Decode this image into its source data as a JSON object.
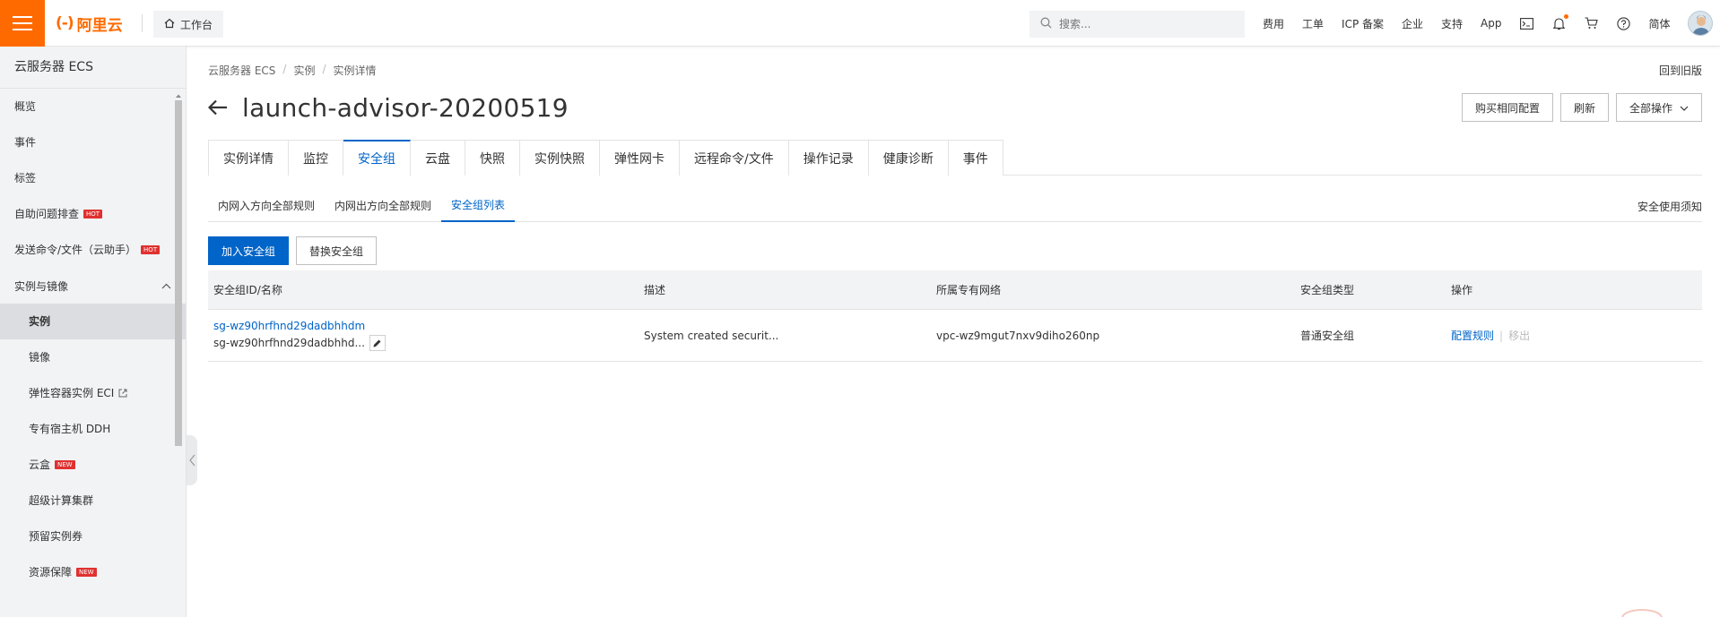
{
  "topbar": {
    "logo_mark": "(-)",
    "logo_text": "阿里云",
    "workbench": "工作台",
    "search_placeholder": "搜索...",
    "links": [
      "费用",
      "工单",
      "ICP 备案",
      "企业",
      "支持",
      "App"
    ],
    "lang": "简体",
    "icons": [
      "terminal-icon",
      "bell-icon",
      "cart-icon",
      "help-icon"
    ]
  },
  "sidebar": {
    "title": "云服务器 ECS",
    "items": [
      {
        "label": "概览"
      },
      {
        "label": "事件"
      },
      {
        "label": "标签"
      },
      {
        "label": "自助问题排查",
        "tag": "HOT"
      },
      {
        "label": "发送命令/文件（云助手）",
        "tag": "HOT"
      }
    ],
    "group": {
      "label": "实例与镜像",
      "items": [
        {
          "label": "实例",
          "active": true
        },
        {
          "label": "镜像"
        },
        {
          "label": "弹性容器实例 ECI",
          "external": true
        },
        {
          "label": "专有宿主机 DDH"
        },
        {
          "label": "云盒",
          "tag": "NEW"
        },
        {
          "label": "超级计算集群"
        },
        {
          "label": "预留实例券"
        },
        {
          "label": "资源保障",
          "tag": "NEW"
        }
      ]
    }
  },
  "breadcrumb": [
    "云服务器 ECS",
    "实例",
    "实例详情"
  ],
  "back_old": "回到旧版",
  "page_title": "launch-advisor-20200519",
  "actions": {
    "buy_same": "购买相同配置",
    "refresh": "刷新",
    "all_ops": "全部操作"
  },
  "tabs": [
    "实例详情",
    "监控",
    "安全组",
    "云盘",
    "快照",
    "实例快照",
    "弹性网卡",
    "远程命令/文件",
    "操作记录",
    "健康诊断",
    "事件"
  ],
  "active_tab": "安全组",
  "subtabs": [
    "内网入方向全部规则",
    "内网出方向全部规则",
    "安全组列表"
  ],
  "active_subtab": "安全组列表",
  "notice": "安全使用须知",
  "buttons": {
    "join": "加入安全组",
    "replace": "替换安全组"
  },
  "table": {
    "headers": [
      "安全组ID/名称",
      "描述",
      "所属专有网络",
      "安全组类型",
      "操作"
    ],
    "rows": [
      {
        "id": "sg-wz90hrfhnd29dadbhhdm",
        "name": "sg-wz90hrfhnd29dadbhhd...",
        "description": "System created securit...",
        "vpc": "vpc-wz9mgut7nxv9diho260np",
        "type": "普通安全组",
        "op_config": "配置规则",
        "op_remove": "移出"
      }
    ]
  },
  "colors": {
    "brand": "#ff6a00",
    "primary": "#0064c8",
    "sidebar_bg": "#f2f3f5"
  }
}
